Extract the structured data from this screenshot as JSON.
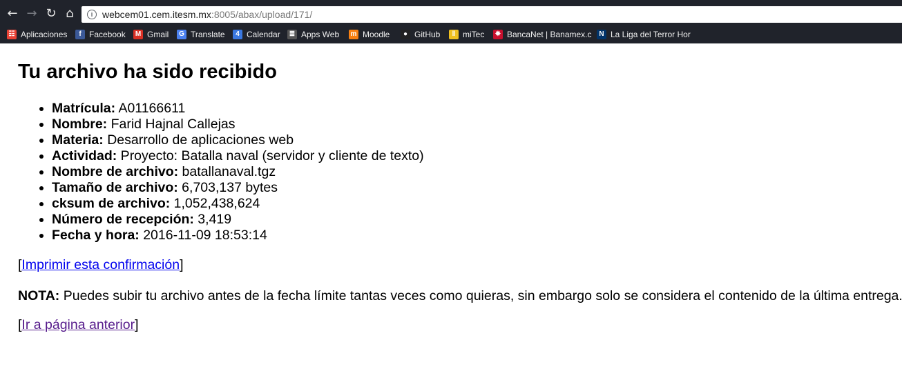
{
  "browser": {
    "url_host": "webcem01.cem.itesm.mx",
    "url_path": ":8005/abax/upload/171/",
    "bookmarks": [
      {
        "label": "Aplicaciones",
        "icon": "apps-grid-icon",
        "color": "#e94235"
      },
      {
        "label": "Facebook",
        "icon": "facebook-icon",
        "color": "#3b5998"
      },
      {
        "label": "Gmail",
        "icon": "gmail-icon",
        "color": "#d93025"
      },
      {
        "label": "Translate",
        "icon": "translate-icon",
        "color": "#4a80f0"
      },
      {
        "label": "Calendar",
        "icon": "calendar-icon",
        "color": "#3a78e0"
      },
      {
        "label": "Apps Web",
        "icon": "document-icon",
        "color": "#555555"
      },
      {
        "label": "Moodle",
        "icon": "moodle-icon",
        "color": "#f98012"
      },
      {
        "label": "GitHub",
        "icon": "github-icon",
        "color": "#222222"
      },
      {
        "label": "miTec",
        "icon": "mitec-icon",
        "color": "#f0c020"
      },
      {
        "label": "BancaNet | Banamex.c",
        "icon": "banamex-icon",
        "color": "#c8102e"
      },
      {
        "label": "La Liga del Terror Hor",
        "icon": "nfl-icon",
        "color": "#013369"
      }
    ]
  },
  "page": {
    "title": "Tu archivo ha sido recibido",
    "items": [
      {
        "key": "Matrícula:",
        "value": " A01166611"
      },
      {
        "key": "Nombre:",
        "value": " Farid Hajnal Callejas"
      },
      {
        "key": "Materia:",
        "value": " Desarrollo de aplicaciones web"
      },
      {
        "key": "Actividad:",
        "value": " Proyecto: Batalla naval (servidor y cliente de texto)"
      },
      {
        "key": "Nombre de archivo:",
        "value": " batallanaval.tgz"
      },
      {
        "key": "Tamaño de archivo:",
        "value": " 6,703,137 bytes"
      },
      {
        "key": "cksum de archivo:",
        "value": " 1,052,438,624"
      },
      {
        "key": "Número de recepción:",
        "value": " 3,419"
      },
      {
        "key": "Fecha y hora:",
        "value": " 2016-11-09 18:53:14"
      }
    ],
    "bracket_open": "[",
    "bracket_close": "]",
    "print_link": "Imprimir esta confirmación",
    "note_label": "NOTA:",
    "note_text": " Puedes subir tu archivo antes de la fecha límite tantas veces como quieras, sin embargo solo se considera el contenido de la última entrega.",
    "back_link": "Ir a página anterior"
  }
}
